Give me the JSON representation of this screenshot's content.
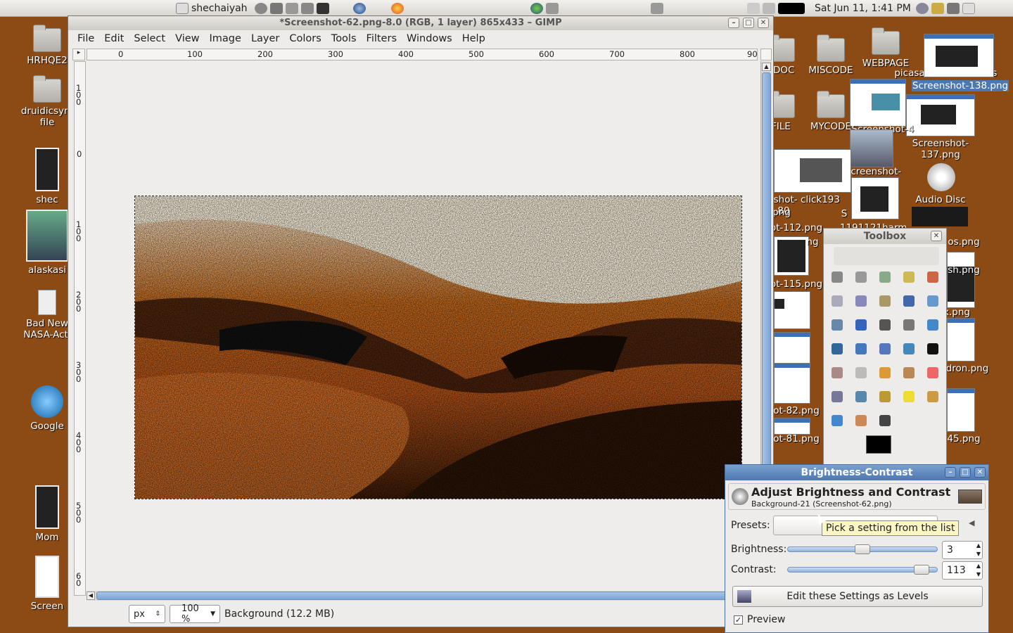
{
  "top_panel": {
    "user": "shechaiyah",
    "datetime": "Sat Jun 11,  1:41 PM"
  },
  "desktop": {
    "left_icons": [
      "HRHQE2",
      "druidicsym file",
      "shec",
      "alaskasi",
      "Bad New NASA-Acti",
      "Google",
      "Mom",
      "Screen"
    ],
    "right_icons": [
      "EDOC",
      "MISCODE",
      "WEBPAGE",
      "picasa",
      "ls",
      "FILE",
      "MYCODE",
      "Screenshot-138.png",
      "Screenshot-137.png",
      "Screenshot-134.png",
      "Screenshot-4",
      "Audio Disc",
      "ot-112.png",
      "ot-115.png",
      "ot-82.png",
      "ot-81.png",
      "os.png",
      "sh.png",
      "x.png",
      "dron.png",
      "45.png",
      "tshot-80",
      "png",
      "ng",
      "click193",
      "1191121harm",
      "S"
    ]
  },
  "gimp": {
    "title": "*Screenshot-62.png-8.0 (RGB, 1 layer) 865x433 – GIMP",
    "menu": [
      "File",
      "Edit",
      "Select",
      "View",
      "Image",
      "Layer",
      "Colors",
      "Tools",
      "Filters",
      "Windows",
      "Help"
    ],
    "hruler_ticks": [
      "0",
      "100",
      "200",
      "300",
      "400",
      "500",
      "600",
      "700",
      "800",
      "90"
    ],
    "vruler_ticks": [
      "1\n0\n0",
      "0",
      "1\n0\n0",
      "2\n0\n0",
      "3\n0\n0",
      "4\n0\n0",
      "5\n0\n0",
      "6\n0"
    ],
    "status": {
      "unit": "px",
      "zoom": "100 %",
      "layer_info": "Background (12.2 MB)"
    }
  },
  "toolbox": {
    "title": "Toolbox"
  },
  "bc_dialog": {
    "title": "Brightness-Contrast",
    "header": "Adjust Brightness and Contrast",
    "subheader": "Background-21 (Screenshot-62.png)",
    "presets_label": "Presets:",
    "brightness_label": "Brightness:",
    "brightness_value": "3",
    "contrast_label": "Contrast:",
    "contrast_value": "113",
    "levels_button": "Edit these Settings as Levels",
    "preview_label": "Preview",
    "tooltip": "Pick a setting from the list"
  },
  "colors": {
    "desktop_bg": "#8c4a14",
    "selection_blue": "#4d77b0"
  }
}
